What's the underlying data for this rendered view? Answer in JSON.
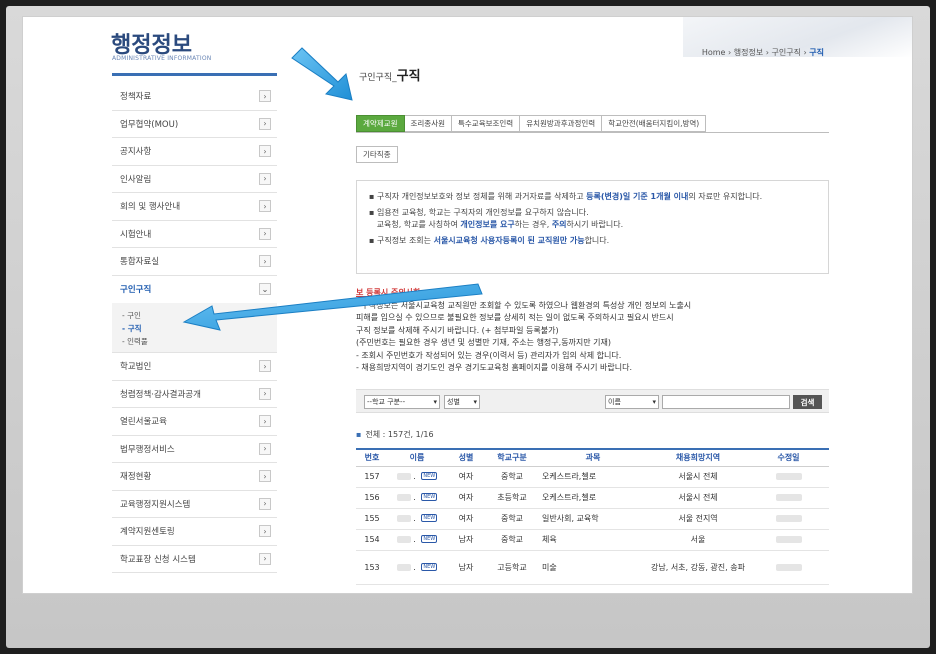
{
  "header": {
    "title": "행정정보",
    "subtitle": "ADMINISTRATIVE INFORMATION"
  },
  "breadcrumb": [
    "Home",
    "행정정보",
    "구인구직",
    "구직"
  ],
  "page_title": {
    "prefix": "구인구직_",
    "main": "구직"
  },
  "sidebar": {
    "items_top": [
      {
        "label": "정책자료"
      },
      {
        "label": "업무협약(MOU)"
      },
      {
        "label": "공지사항"
      },
      {
        "label": "인사알림"
      },
      {
        "label": "회의 및 행사안내"
      },
      {
        "label": "시험안내"
      },
      {
        "label": "통합자료실"
      }
    ],
    "active": {
      "label": "구인구직",
      "sub": [
        "구인",
        "구직",
        "인력풀"
      ]
    },
    "items_bottom": [
      {
        "label": "학교법인"
      },
      {
        "label": "청렴정책·감사결과공개"
      },
      {
        "label": "열린서울교육"
      },
      {
        "label": "법무행정서비스"
      },
      {
        "label": "재정현황"
      },
      {
        "label": "교육행정지원시스템"
      },
      {
        "label": "계약지원센토링"
      },
      {
        "label": "학교표장 신청 시스템"
      }
    ]
  },
  "tabs": [
    "계약제교원",
    "조리종사원",
    "특수교육보조인력",
    "유치원방과후과정인력",
    "학교안전(배움터지킴이,방역)"
  ],
  "tab_row2": "기타직종",
  "notice": {
    "line1a": "구직자 개인정보보호와 정보 정체를 위해 과거자료를 삭제하고 ",
    "line1b": "등록(변경)일 기준 1개월 이내",
    "line1c": "의 자료만 유지합니다.",
    "line2a": "임용전 교육청, 학교는 구직자의 개인정보를 요구하지 않습니다.",
    "line2b": "교육청, 학교를 사칭하여 ",
    "line2c": "개인정보를 요구",
    "line2d": "하는 경우, ",
    "line2e": "주의",
    "line2f": "하시기 바랍니다.",
    "line3a": "구직정보 조회는 ",
    "line3b": "서울시교육청 사용자등록이 된 교직원만 가능",
    "line3c": "합니다."
  },
  "warning": {
    "head": "보 등록시 주의사항",
    "lines": [
      "- 구직정보는 서울시교육청 교직원만 조회할 수 있도록 하였으나 웹환경의 특성상 개인 정보의 노출시",
      "   피해를 입으실 수 있으므로 불필요한 정보를 상세히 적는 일이 없도록 주의하시고 필요시 반드시",
      "   구직 정보를 삭제해 주시기 바랍니다. (+ 첨부파일 등록불가)",
      "   (주민번호는 필요한 경우 생년 및 성별만 기재, 주소는 행정구,동까지만 기재)",
      "- 조회시 주민번호가 작성되어 있는 경우(이력서 등) 관리자가 임의 삭제 합니다.",
      "- 채용희망지역이 경기도인 경우 경기도교육청 홈페이지를 이용해 주시기 바랍니다."
    ]
  },
  "search": {
    "school_select": "--학교 구분--",
    "gender_select": "성별",
    "field_select": "이름",
    "button": "검색"
  },
  "total": "전체 : 157건, 1/16",
  "table": {
    "headers": [
      "번호",
      "이름",
      "성별",
      "학교구분",
      "과목",
      "채용희망지역",
      "수정일"
    ],
    "rows": [
      {
        "no": "157",
        "gender": "여자",
        "school": "중학교",
        "subject": "오케스트라,첼로",
        "region": "서울시 전체"
      },
      {
        "no": "156",
        "gender": "여자",
        "school": "초등학교",
        "subject": "오케스트라,첼로",
        "region": "서울시 전체"
      },
      {
        "no": "155",
        "gender": "여자",
        "school": "중학교",
        "subject": "일반사회, 교육학",
        "region": "서울 전지역"
      },
      {
        "no": "154",
        "gender": "남자",
        "school": "중학교",
        "subject": "체육",
        "region": "서울"
      },
      {
        "no": "153",
        "gender": "남자",
        "school": "고등학교",
        "subject": "미술",
        "region": "강남, 서초, 강동, 광진, 송파"
      }
    ],
    "new_badge": "NEW"
  },
  "colors": {
    "brand": "#2b4a7e",
    "tab_active": "#5ba93f",
    "link": "#2a58a8",
    "warning": "#d23a3a",
    "arrow": "#35a3e8"
  }
}
